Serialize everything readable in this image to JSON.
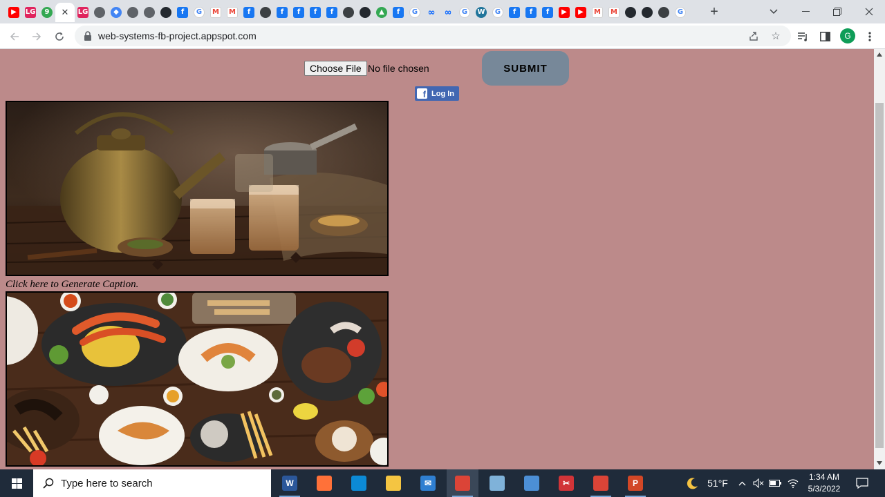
{
  "browser": {
    "tabs": [
      {
        "icon": "youtube-icon",
        "glyph": "▶",
        "kind": "yt"
      },
      {
        "icon": "lg-app-icon",
        "glyph": "LG",
        "kind": "lg"
      },
      {
        "icon": "green-circle-icon",
        "glyph": "9",
        "kind": "green"
      },
      {
        "icon": "current-tab-close-icon",
        "glyph": "✕",
        "kind": "active"
      },
      {
        "icon": "lg-app-icon",
        "glyph": "LG",
        "kind": "lg"
      },
      {
        "icon": "globe-icon",
        "glyph": "",
        "kind": "grey"
      },
      {
        "icon": "diamond-icon",
        "glyph": "◆",
        "kind": "blue"
      },
      {
        "icon": "globe-icon",
        "glyph": "",
        "kind": "grey"
      },
      {
        "icon": "globe-icon",
        "glyph": "",
        "kind": "grey"
      },
      {
        "icon": "github-icon",
        "glyph": "",
        "kind": "gh"
      },
      {
        "icon": "facebook-icon",
        "glyph": "f",
        "kind": "fb"
      },
      {
        "icon": "google-icon",
        "glyph": "G",
        "kind": "gg"
      },
      {
        "icon": "gmail-icon",
        "glyph": "M",
        "kind": "gm"
      },
      {
        "icon": "gmail-icon",
        "glyph": "M",
        "kind": "gm"
      },
      {
        "icon": "facebook-icon",
        "glyph": "f",
        "kind": "fb"
      },
      {
        "icon": "chromium-icon",
        "glyph": "",
        "kind": "dark"
      },
      {
        "icon": "facebook-icon",
        "glyph": "f",
        "kind": "fb"
      },
      {
        "icon": "facebook-icon",
        "glyph": "f",
        "kind": "fb"
      },
      {
        "icon": "facebook-icon",
        "glyph": "f",
        "kind": "fb"
      },
      {
        "icon": "facebook-icon",
        "glyph": "f",
        "kind": "fb"
      },
      {
        "icon": "chromium-icon",
        "glyph": "",
        "kind": "dark"
      },
      {
        "icon": "github-icon",
        "glyph": "",
        "kind": "gh"
      },
      {
        "icon": "chart-icon",
        "glyph": "▲",
        "kind": "green"
      },
      {
        "icon": "facebook-icon",
        "glyph": "f",
        "kind": "fb"
      },
      {
        "icon": "google-icon",
        "glyph": "G",
        "kind": "gg"
      },
      {
        "icon": "meta-icon",
        "glyph": "∞",
        "kind": "meta"
      },
      {
        "icon": "meta-icon",
        "glyph": "∞",
        "kind": "meta"
      },
      {
        "icon": "google-icon",
        "glyph": "G",
        "kind": "gg"
      },
      {
        "icon": "wordpress-icon",
        "glyph": "W",
        "kind": "wp"
      },
      {
        "icon": "google-icon",
        "glyph": "G",
        "kind": "gg"
      },
      {
        "icon": "facebook-icon",
        "glyph": "f",
        "kind": "fb"
      },
      {
        "icon": "facebook-icon",
        "glyph": "f",
        "kind": "fb"
      },
      {
        "icon": "facebook-icon",
        "glyph": "f",
        "kind": "fb"
      },
      {
        "icon": "youtube-icon",
        "glyph": "▶",
        "kind": "yt"
      },
      {
        "icon": "youtube-icon",
        "glyph": "▶",
        "kind": "yt"
      },
      {
        "icon": "gmail-icon",
        "glyph": "M",
        "kind": "gm"
      },
      {
        "icon": "gmail-icon",
        "glyph": "M",
        "kind": "gm"
      },
      {
        "icon": "github-icon",
        "glyph": "",
        "kind": "gh"
      },
      {
        "icon": "github-icon",
        "glyph": "",
        "kind": "gh"
      },
      {
        "icon": "chromium-icon",
        "glyph": "",
        "kind": "dark"
      },
      {
        "icon": "google-icon",
        "glyph": "G",
        "kind": "gg"
      }
    ],
    "url": "web-systems-fb-project.appspot.com",
    "profile_initial": "G"
  },
  "page": {
    "choose_file_label": "Choose File",
    "file_status": "No file chosen",
    "submit_label": "SUBMIT",
    "fb_login_label": "Log In",
    "fb_logo_glyph": "f",
    "caption_link": "Click here to Generate Caption.",
    "background_color": "#bc8a8a"
  },
  "taskbar": {
    "search_placeholder": "Type here to search",
    "apps": [
      {
        "icon": "word-icon",
        "glyph": "W",
        "color": "#2b579a"
      },
      {
        "icon": "firefox-icon",
        "glyph": "",
        "color": "#ff7139"
      },
      {
        "icon": "edge-icon",
        "glyph": "",
        "color": "#0c8ad6"
      },
      {
        "icon": "file-explorer-icon",
        "glyph": "",
        "color": "#f4c542"
      },
      {
        "icon": "mail-icon",
        "glyph": "✉",
        "color": "#2f7fd1"
      },
      {
        "icon": "chrome-icon",
        "glyph": "",
        "color": "#db4437"
      },
      {
        "icon": "notepad-icon",
        "glyph": "",
        "color": "#7fb2d9"
      },
      {
        "icon": "remote-desktop-icon",
        "glyph": "",
        "color": "#4c8fd6"
      },
      {
        "icon": "snipping-tool-icon",
        "glyph": "✂",
        "color": "#d13438"
      },
      {
        "icon": "chrome-icon",
        "glyph": "",
        "color": "#db4437"
      },
      {
        "icon": "powerpoint-icon",
        "glyph": "P",
        "color": "#d24726"
      }
    ],
    "weather": "51°F",
    "time": "1:34 AM",
    "date": "5/3/2022"
  }
}
